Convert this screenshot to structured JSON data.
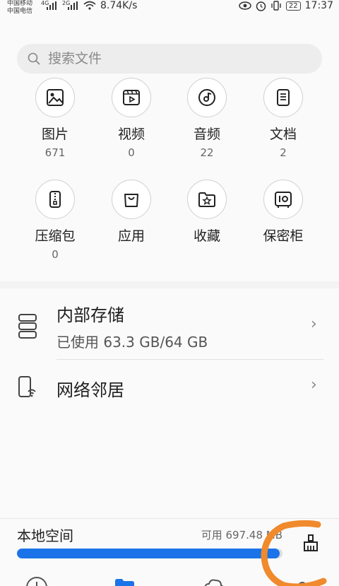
{
  "status_bar": {
    "carrier_1": "中国移动",
    "carrier_2": "中国电信",
    "net_type_1": "4G",
    "net_type_2": "2G",
    "net_speed": "8.74K/s",
    "battery": "22",
    "time": "17:37"
  },
  "search": {
    "placeholder": "搜索文件"
  },
  "categories": [
    {
      "label": "图片",
      "count": "671",
      "icon": "image-icon"
    },
    {
      "label": "视频",
      "count": "0",
      "icon": "video-icon"
    },
    {
      "label": "音频",
      "count": "22",
      "icon": "audio-icon"
    },
    {
      "label": "文档",
      "count": "2",
      "icon": "document-icon"
    },
    {
      "label": "压缩包",
      "count": "0",
      "icon": "archive-icon"
    },
    {
      "label": "应用",
      "count": "",
      "icon": "app-icon"
    },
    {
      "label": "收藏",
      "count": "",
      "icon": "favorites-icon"
    },
    {
      "label": "保密柜",
      "count": "",
      "icon": "safe-icon"
    }
  ],
  "storage": {
    "title": "内部存储",
    "usage": "已使用 63.3 GB/64 GB"
  },
  "network": {
    "title": "网络邻居"
  },
  "local_space": {
    "title": "本地空间",
    "free": "可用 697.48 MB",
    "used_fraction": 0.989
  },
  "colors": {
    "accent": "#1a73e8",
    "annotation": "#f08a2c"
  }
}
